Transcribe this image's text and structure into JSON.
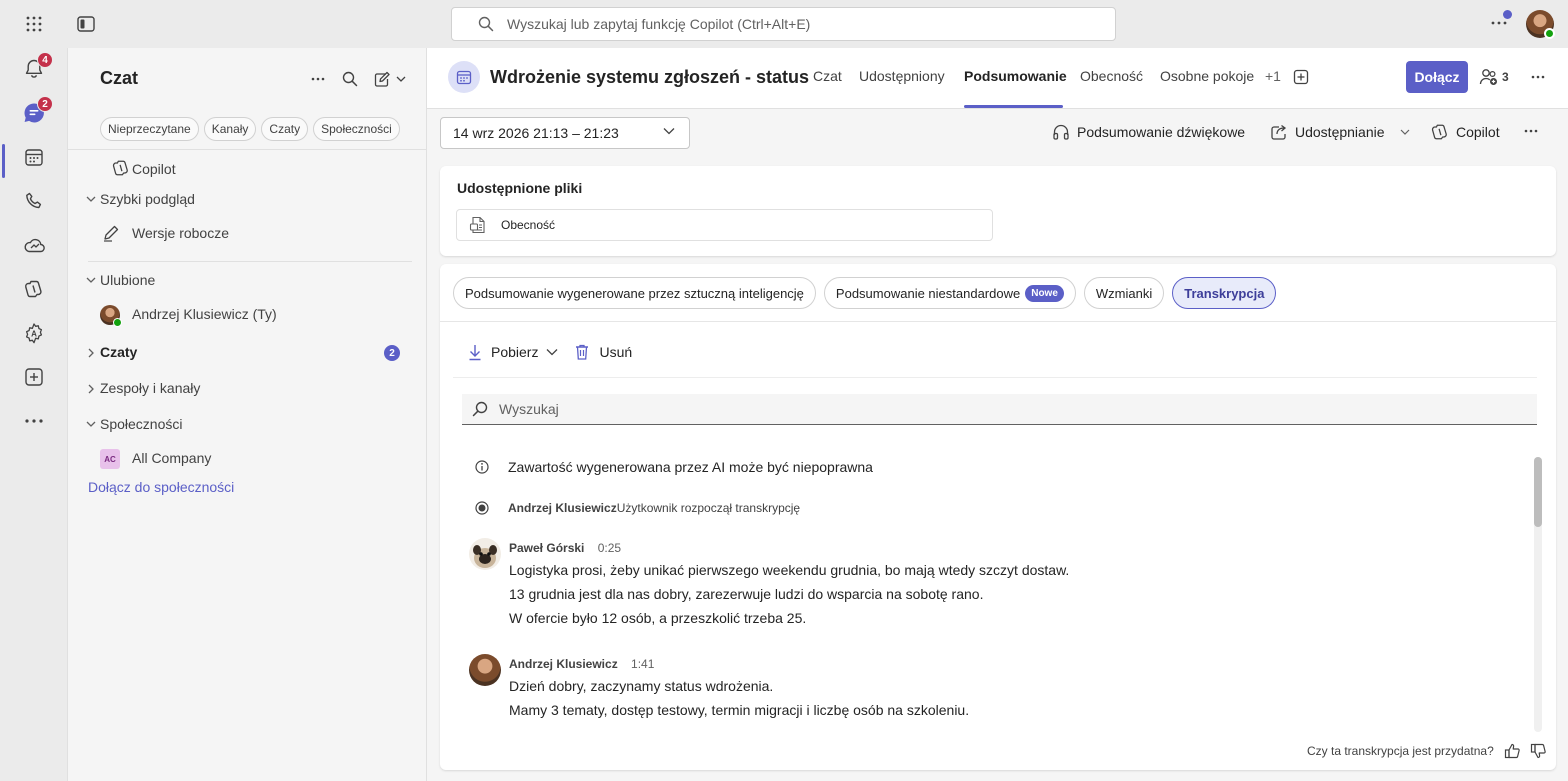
{
  "topbar": {
    "search_placeholder": "Wyszukaj lub zapytaj funkcję Copilot (Ctrl+Alt+E)"
  },
  "rail": {
    "activity_badge": "4",
    "chat_badge": "2"
  },
  "chatpanel": {
    "title": "Czat",
    "filters": [
      "Nieprzeczytane",
      "Kanały",
      "Czaty",
      "Społeczności"
    ],
    "copilot": "Copilot",
    "quick_view": "Szybki podgląd",
    "drafts": "Wersje robocze",
    "favorites": "Ulubione",
    "favorite_user": "Andrzej Klusiewicz (Ty)",
    "chats": "Czaty",
    "chats_count": "2",
    "teams": "Zespoły i kanały",
    "communities": "Społeczności",
    "community_initials": "AC",
    "community_name": "All Company",
    "join_communities": "Dołącz do społeczności"
  },
  "meeting": {
    "title": "Wdrożenie systemu zgłoszeń - status",
    "tabs": [
      "Czat",
      "Udostępniony",
      "Podsumowanie",
      "Obecność",
      "Osobne pokoje",
      "+1"
    ],
    "active_tab": "Podsumowanie",
    "join_label": "Dołącz",
    "people_count": "3"
  },
  "toolbar": {
    "date_range": "14 wrz 2026 21:13 – 21:23",
    "audio_summary": "Podsumowanie dźwiękowe",
    "share": "Udostępnianie",
    "copilot": "Copilot"
  },
  "shared_files": {
    "title": "Udostępnione pliki",
    "file_name": "Obecność"
  },
  "summary_tabs": {
    "ai_summary": "Podsumowanie wygenerowane przez sztuczną inteligencję",
    "custom_summary": "Podsumowanie niestandardowe",
    "new_badge": "Nowe",
    "mentions": "Wzmianki",
    "transcript": "Transkrypcja"
  },
  "transcript": {
    "download": "Pobierz",
    "delete": "Usuń",
    "search_placeholder": "Wyszukaj",
    "ai_notice": "Zawartość wygenerowana przez AI może być niepoprawna",
    "start_user": "Andrzej Klusiewicz",
    "start_text": "Użytkownik rozpoczął transkrypcję",
    "entries": [
      {
        "speaker": "Paweł Górski",
        "time": "0:25",
        "lines": [
          "Logistyka prosi, żeby unikać pierwszego weekendu grudnia, bo mają wtedy szczyt dostaw.",
          "13 grudnia jest dla nas dobry, zarezerwuje ludzi do wsparcia na sobotę rano.",
          "W ofercie było 12 osób, a przeszkolić trzeba 25."
        ]
      },
      {
        "speaker": "Andrzej Klusiewicz",
        "time": "1:41",
        "lines": [
          "Dzień dobry, zaczynamy status wdrożenia.",
          "Mamy 3 tematy, dostęp testowy, termin migracji i liczbę osób na szkoleniu."
        ]
      }
    ],
    "feedback_question": "Czy ta transkrypcja jest przydatna?"
  }
}
